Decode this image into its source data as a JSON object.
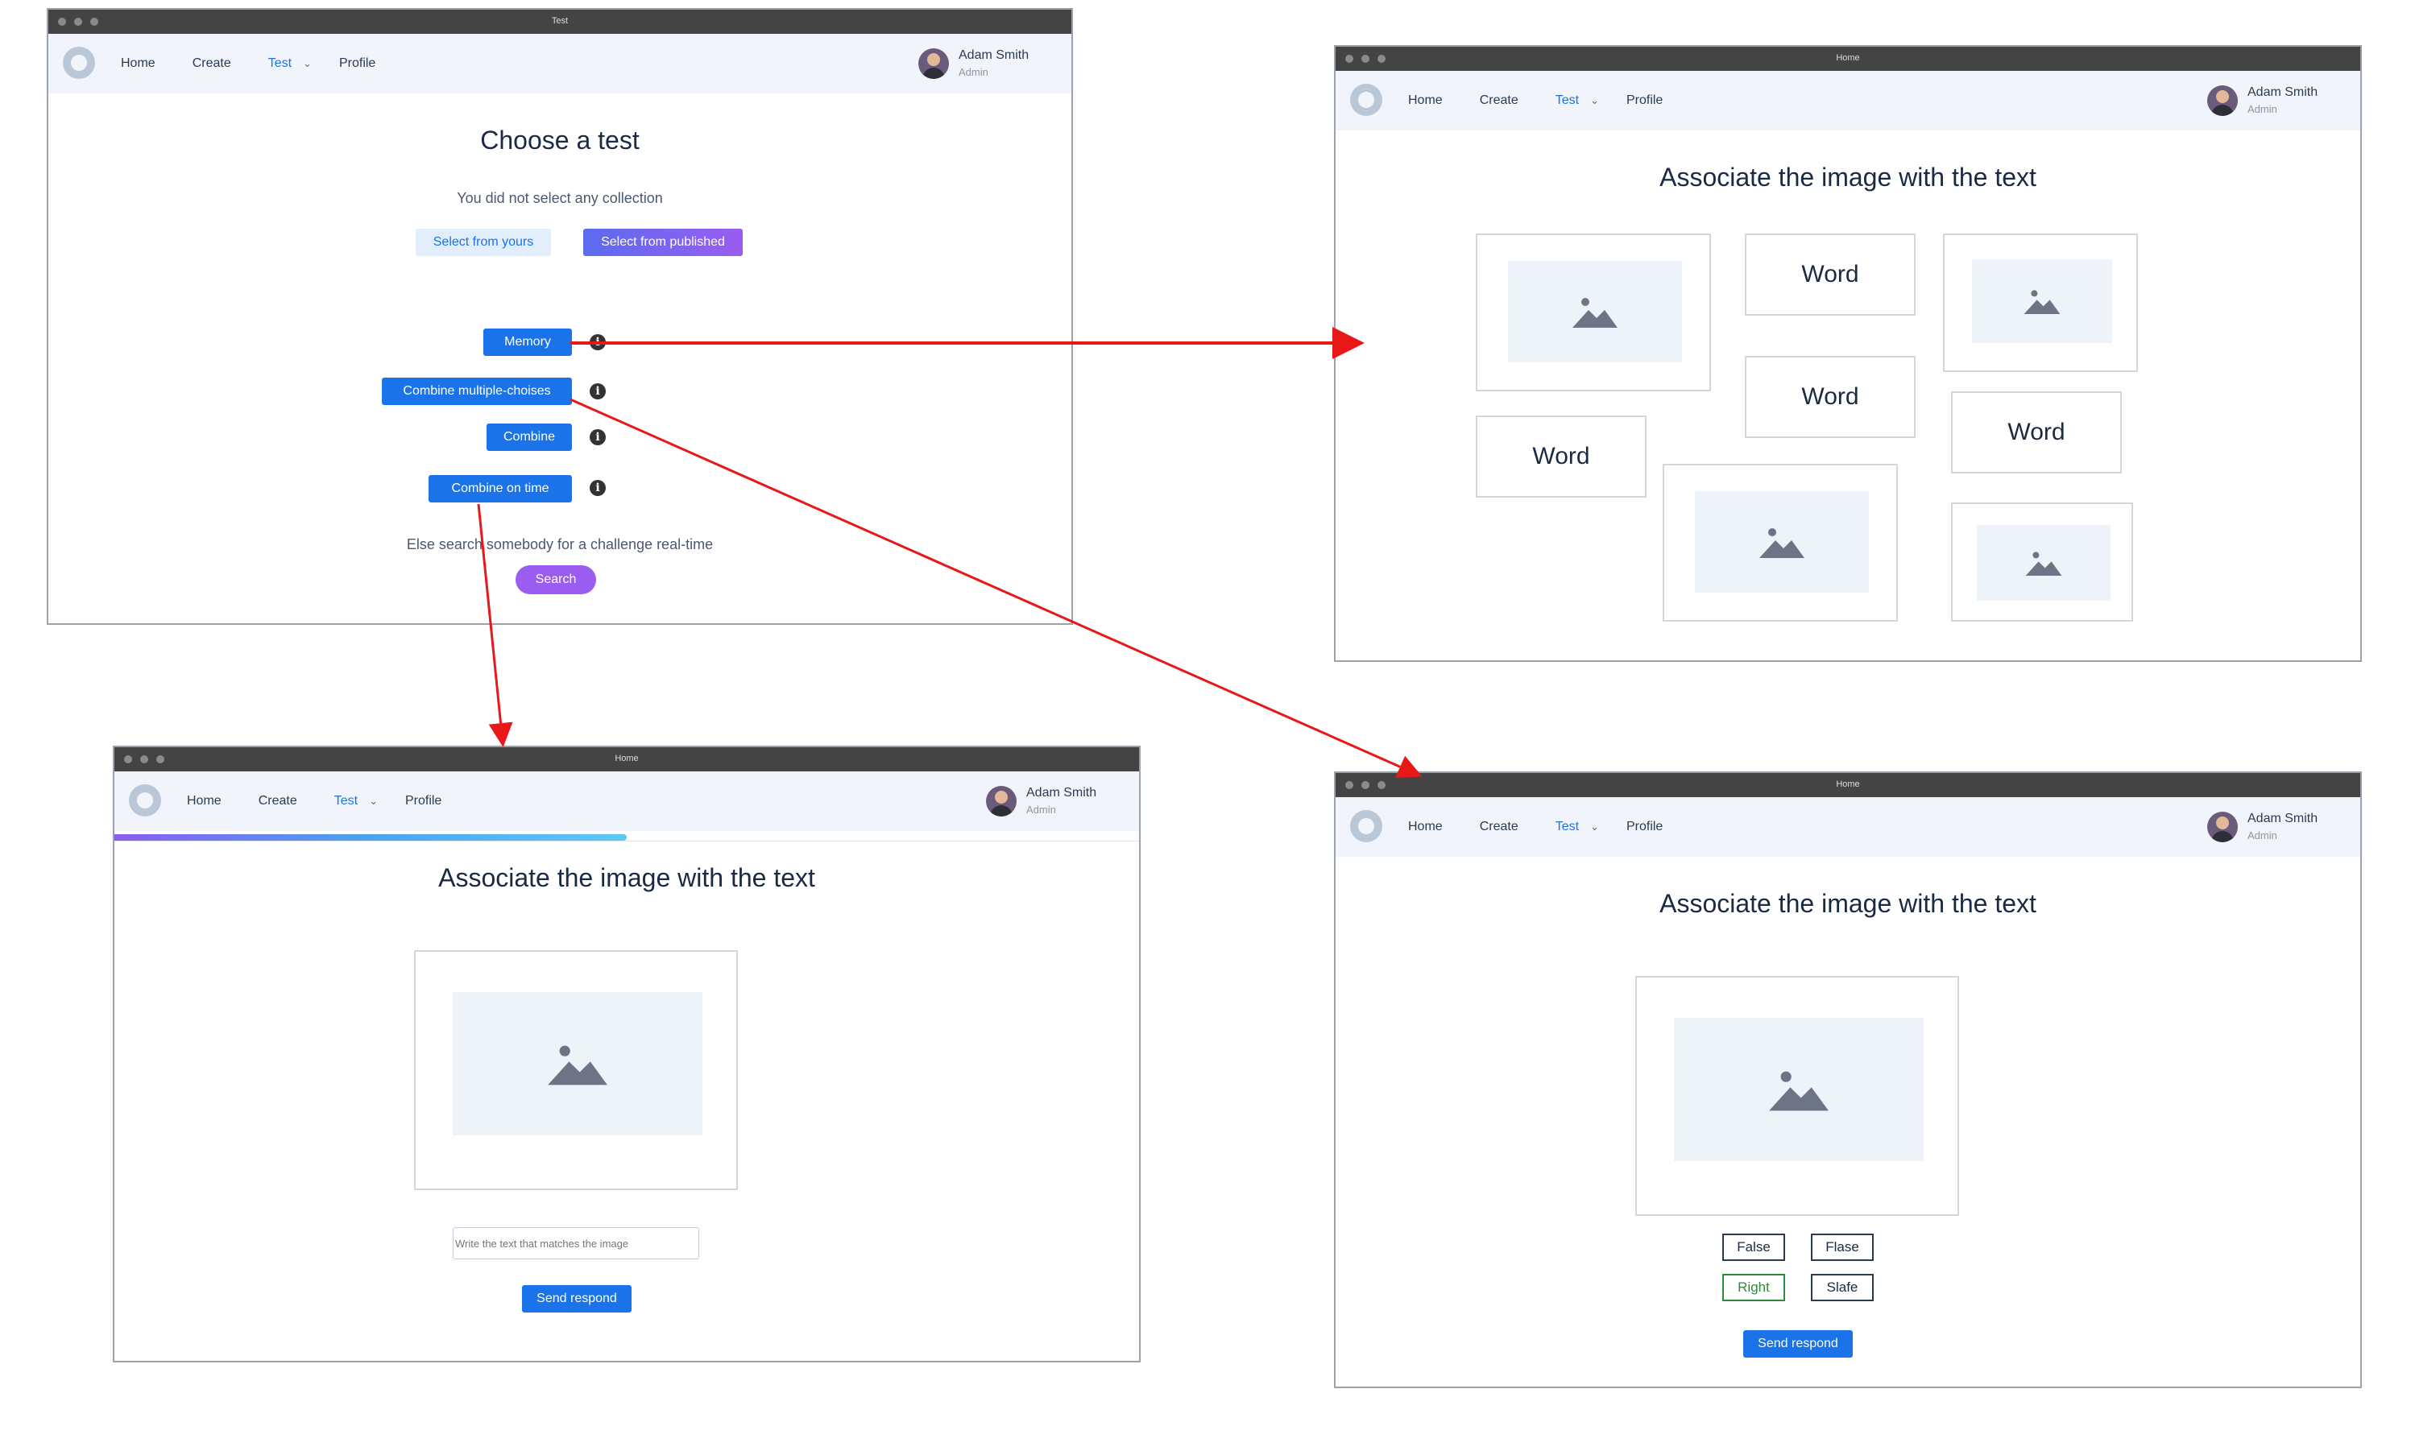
{
  "nav": {
    "home": "Home",
    "create": "Create",
    "test": "Test",
    "profile": "Profile",
    "user_name": "Adam Smith",
    "user_role": "Admin"
  },
  "win1": {
    "title": "Test",
    "heading": "Choose a test",
    "no_collection": "You did not select any collection",
    "select_yours": "Select from yours",
    "select_published": "Select from published",
    "tests": [
      "Memory",
      "Combine multiple-choises",
      "Combine",
      "Combine on time"
    ],
    "search_text": "Else search somebody for a challenge real-time",
    "search_button": "Search"
  },
  "win2": {
    "title": "Home",
    "heading": "Associate the image with the text",
    "words": [
      "Word",
      "Word",
      "Word",
      "Word"
    ]
  },
  "win3": {
    "title": "Home",
    "heading": "Associate the image with the text",
    "progress_fraction": 0.5,
    "input_placeholder": "Write the text that matches the image",
    "send": "Send respond"
  },
  "win4": {
    "title": "Home",
    "heading": "Associate the image with the text",
    "options": [
      "False",
      "Flase",
      "Right",
      "Slafe"
    ],
    "send": "Send respond"
  },
  "colors": {
    "primary": "#1a73e8",
    "purple": "#9b5cf0",
    "arrow": "#e81818",
    "correct": "#2e8b3e"
  }
}
